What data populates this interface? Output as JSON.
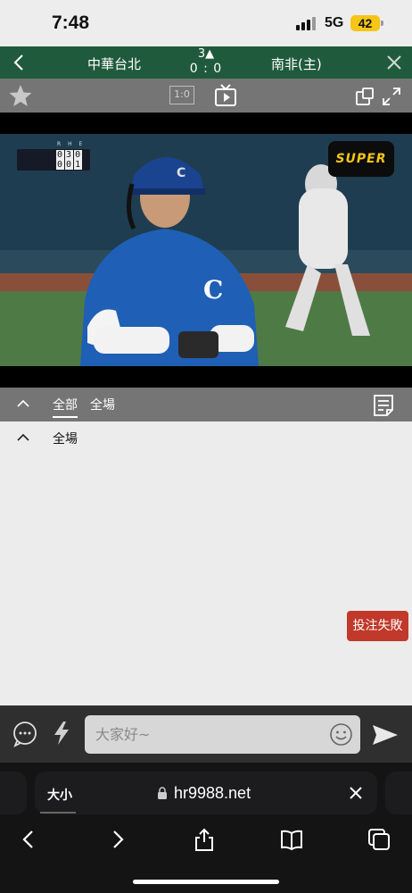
{
  "status_bar": {
    "time": "7:48",
    "network": "5G",
    "battery": "42"
  },
  "match": {
    "home_team": "中華台北",
    "away_team": "南非(主)",
    "inning": "3▲",
    "score": "0 : 0",
    "header_color": "#1f5a3c"
  },
  "toolbar": {
    "ratio_label": "1:0"
  },
  "video": {
    "scoreboard_header": "R H E",
    "away_line": [
      "0",
      "3",
      "0"
    ],
    "home_line": [
      "0",
      "0",
      "1"
    ],
    "broadcaster_logo": "SUPER"
  },
  "tabs": {
    "items": [
      {
        "label": "全部",
        "active": true
      },
      {
        "label": "全場",
        "active": false
      }
    ]
  },
  "content": {
    "section_label": "全場",
    "fail_badge": "投注失敗",
    "fail_color": "#c0392b"
  },
  "chat": {
    "placeholder": "大家好~"
  },
  "browser": {
    "text_size_label": "大小",
    "url": "hr9988.net"
  }
}
